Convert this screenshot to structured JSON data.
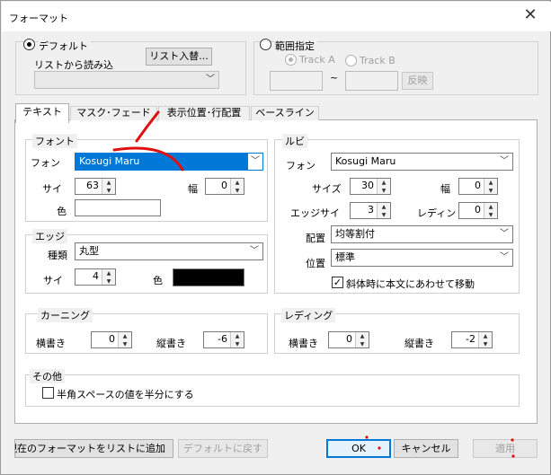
{
  "window": {
    "title": "フォーマット",
    "close_glyph": "✕"
  },
  "source": {
    "default_radio": "デフォルト",
    "load_from_list": "リストから読み込",
    "list_swap_button": "リスト入替...",
    "range_radio": "範囲指定",
    "track_a": "Track A",
    "track_b": "Track B",
    "tilde": "~",
    "apply_range_button": "反映"
  },
  "tabs": [
    {
      "label": "テキスト"
    },
    {
      "label": "マスク･フェード"
    },
    {
      "label": "表示位置･行配置"
    },
    {
      "label": "ベースライン"
    }
  ],
  "font_group": {
    "title": "フォント",
    "font_label": "フォン",
    "font_value": "Kosugi Maru",
    "size_label": "サイ",
    "size_value": "63",
    "width_label": "幅",
    "width_value": "0",
    "color_label": "色",
    "color_hex": "#ffffff"
  },
  "ruby_group": {
    "title": "ルビ",
    "font_label": "フォン",
    "font_value": "Kosugi Maru",
    "size_label": "サイズ",
    "size_value": "30",
    "width_label": "幅",
    "width_value": "0",
    "edge_size_label": "エッジサイ",
    "edge_size_value": "3",
    "leading_label": "レディン",
    "leading_value": "0",
    "align_label": "配置",
    "align_value": "均等割付",
    "position_label": "位置",
    "position_value": "標準",
    "italic_check_label": "斜体時に本文にあわせて移動",
    "italic_checked": true
  },
  "edge_group": {
    "title": "エッジ",
    "type_label": "種類",
    "type_value": "丸型",
    "size_label": "サイ",
    "size_value": "4",
    "color_label": "色",
    "color_hex": "#000000"
  },
  "kerning_group": {
    "title": "カーニング",
    "horizontal_label": "横書き",
    "horizontal_value": "0",
    "vertical_label": "縦書き",
    "vertical_value": "-6"
  },
  "leading_group": {
    "title": "レディング",
    "horizontal_label": "横書き",
    "horizontal_value": "0",
    "vertical_label": "縦書き",
    "vertical_value": "-2"
  },
  "other_group": {
    "title": "その他",
    "half_space_label": "半角スペースの値を半分にする",
    "half_space_checked": false
  },
  "footer": {
    "add_current_button": "現在のフォーマットをリストに追加",
    "reset_default_button": "デフォルトに戻す",
    "ok_button": "OK",
    "cancel_button": "キャンセル",
    "apply_button": "適用"
  },
  "colors": {
    "accent": "#0078d7",
    "annotation_red": "#e01010"
  }
}
